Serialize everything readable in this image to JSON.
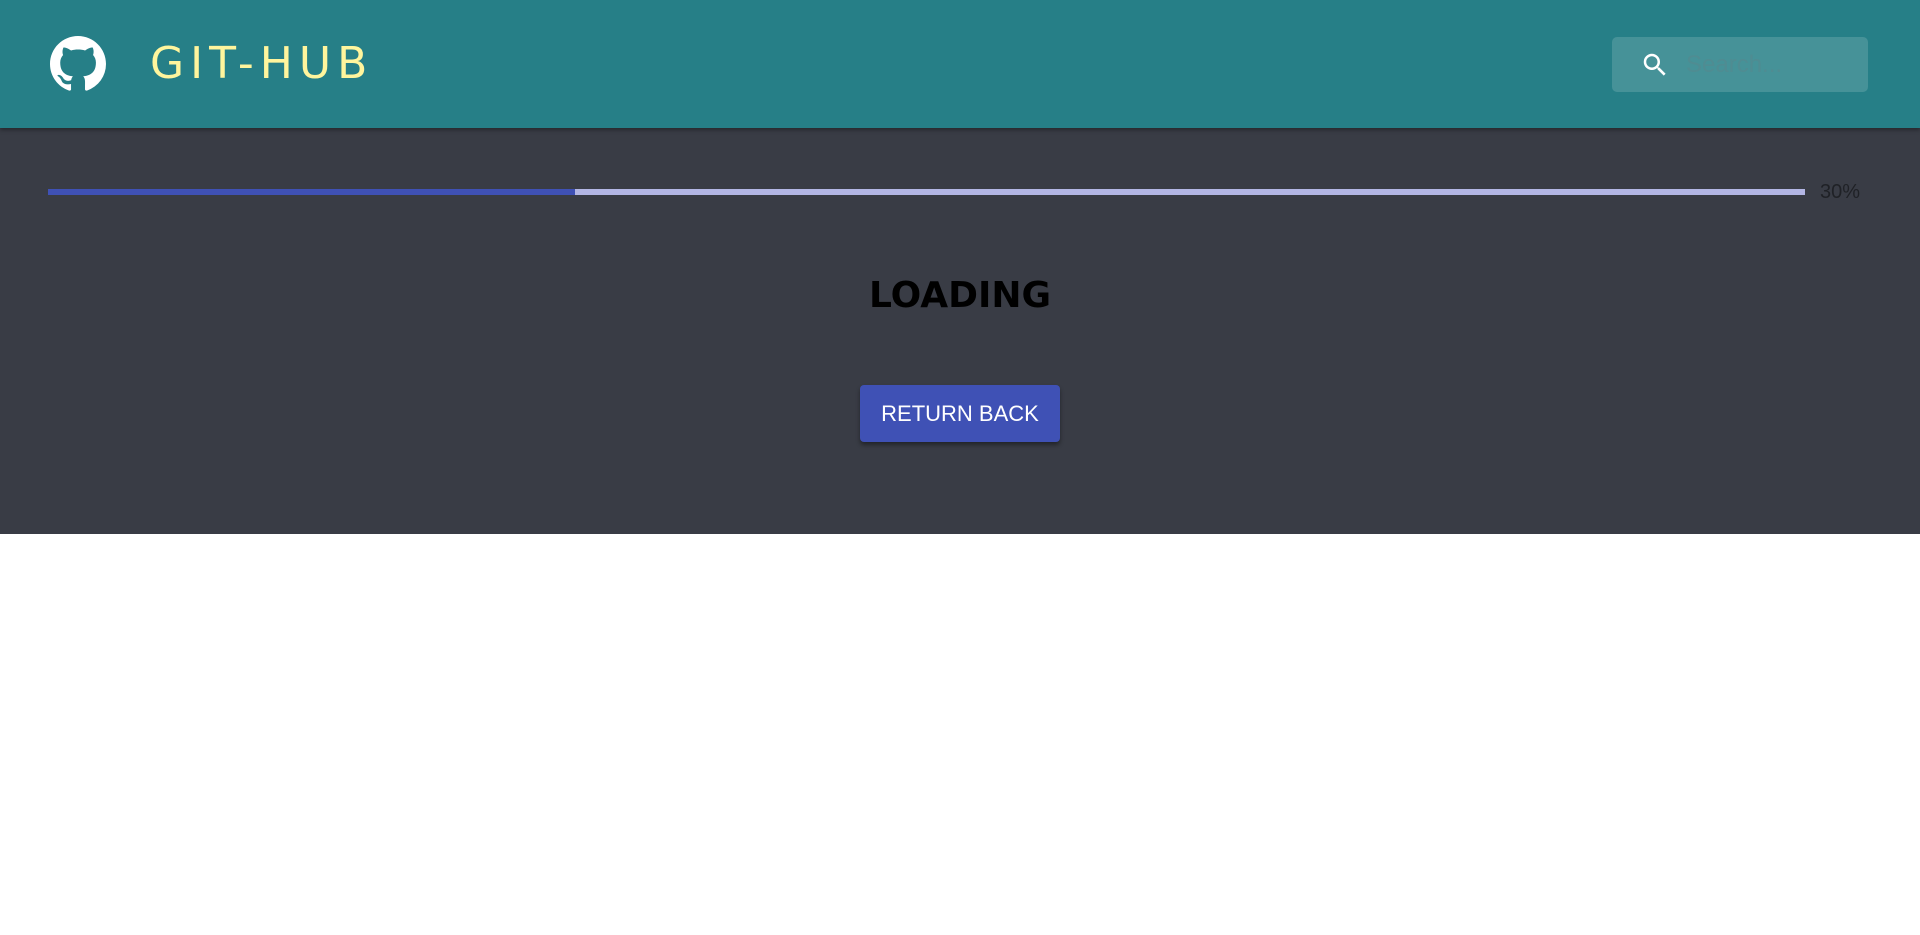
{
  "header": {
    "brand": "GIT-HUB",
    "logo_icon": "github-icon",
    "brand_color": "#fff59d",
    "background_color": "#267f87",
    "search": {
      "placeholder": "Search...",
      "value": "",
      "icon": "search-icon"
    }
  },
  "main": {
    "progress": {
      "value": 30,
      "label": "30%",
      "fill_color": "#3f51b5",
      "track_color": "#b3b6e4"
    },
    "title": "LOADING",
    "return_button_label": "RETURN BACK",
    "background_color": "#393c45"
  }
}
